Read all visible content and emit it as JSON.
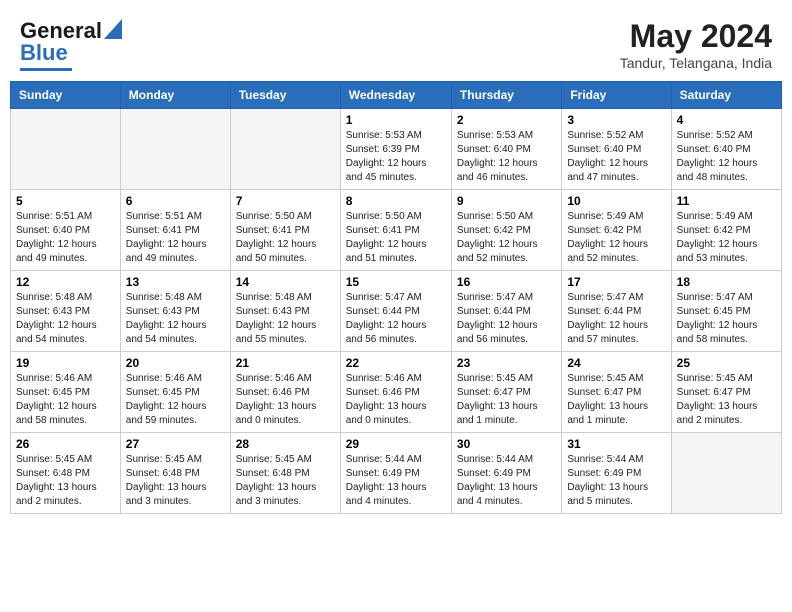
{
  "header": {
    "logo_line1": "General",
    "logo_line2": "Blue",
    "title": "May 2024",
    "subtitle": "Tandur, Telangana, India"
  },
  "days_of_week": [
    "Sunday",
    "Monday",
    "Tuesday",
    "Wednesday",
    "Thursday",
    "Friday",
    "Saturday"
  ],
  "weeks": [
    [
      {
        "day": "",
        "info": ""
      },
      {
        "day": "",
        "info": ""
      },
      {
        "day": "",
        "info": ""
      },
      {
        "day": "1",
        "info": "Sunrise: 5:53 AM\nSunset: 6:39 PM\nDaylight: 12 hours\nand 45 minutes."
      },
      {
        "day": "2",
        "info": "Sunrise: 5:53 AM\nSunset: 6:40 PM\nDaylight: 12 hours\nand 46 minutes."
      },
      {
        "day": "3",
        "info": "Sunrise: 5:52 AM\nSunset: 6:40 PM\nDaylight: 12 hours\nand 47 minutes."
      },
      {
        "day": "4",
        "info": "Sunrise: 5:52 AM\nSunset: 6:40 PM\nDaylight: 12 hours\nand 48 minutes."
      }
    ],
    [
      {
        "day": "5",
        "info": "Sunrise: 5:51 AM\nSunset: 6:40 PM\nDaylight: 12 hours\nand 49 minutes."
      },
      {
        "day": "6",
        "info": "Sunrise: 5:51 AM\nSunset: 6:41 PM\nDaylight: 12 hours\nand 49 minutes."
      },
      {
        "day": "7",
        "info": "Sunrise: 5:50 AM\nSunset: 6:41 PM\nDaylight: 12 hours\nand 50 minutes."
      },
      {
        "day": "8",
        "info": "Sunrise: 5:50 AM\nSunset: 6:41 PM\nDaylight: 12 hours\nand 51 minutes."
      },
      {
        "day": "9",
        "info": "Sunrise: 5:50 AM\nSunset: 6:42 PM\nDaylight: 12 hours\nand 52 minutes."
      },
      {
        "day": "10",
        "info": "Sunrise: 5:49 AM\nSunset: 6:42 PM\nDaylight: 12 hours\nand 52 minutes."
      },
      {
        "day": "11",
        "info": "Sunrise: 5:49 AM\nSunset: 6:42 PM\nDaylight: 12 hours\nand 53 minutes."
      }
    ],
    [
      {
        "day": "12",
        "info": "Sunrise: 5:48 AM\nSunset: 6:43 PM\nDaylight: 12 hours\nand 54 minutes."
      },
      {
        "day": "13",
        "info": "Sunrise: 5:48 AM\nSunset: 6:43 PM\nDaylight: 12 hours\nand 54 minutes."
      },
      {
        "day": "14",
        "info": "Sunrise: 5:48 AM\nSunset: 6:43 PM\nDaylight: 12 hours\nand 55 minutes."
      },
      {
        "day": "15",
        "info": "Sunrise: 5:47 AM\nSunset: 6:44 PM\nDaylight: 12 hours\nand 56 minutes."
      },
      {
        "day": "16",
        "info": "Sunrise: 5:47 AM\nSunset: 6:44 PM\nDaylight: 12 hours\nand 56 minutes."
      },
      {
        "day": "17",
        "info": "Sunrise: 5:47 AM\nSunset: 6:44 PM\nDaylight: 12 hours\nand 57 minutes."
      },
      {
        "day": "18",
        "info": "Sunrise: 5:47 AM\nSunset: 6:45 PM\nDaylight: 12 hours\nand 58 minutes."
      }
    ],
    [
      {
        "day": "19",
        "info": "Sunrise: 5:46 AM\nSunset: 6:45 PM\nDaylight: 12 hours\nand 58 minutes."
      },
      {
        "day": "20",
        "info": "Sunrise: 5:46 AM\nSunset: 6:45 PM\nDaylight: 12 hours\nand 59 minutes."
      },
      {
        "day": "21",
        "info": "Sunrise: 5:46 AM\nSunset: 6:46 PM\nDaylight: 13 hours\nand 0 minutes."
      },
      {
        "day": "22",
        "info": "Sunrise: 5:46 AM\nSunset: 6:46 PM\nDaylight: 13 hours\nand 0 minutes."
      },
      {
        "day": "23",
        "info": "Sunrise: 5:45 AM\nSunset: 6:47 PM\nDaylight: 13 hours\nand 1 minute."
      },
      {
        "day": "24",
        "info": "Sunrise: 5:45 AM\nSunset: 6:47 PM\nDaylight: 13 hours\nand 1 minute."
      },
      {
        "day": "25",
        "info": "Sunrise: 5:45 AM\nSunset: 6:47 PM\nDaylight: 13 hours\nand 2 minutes."
      }
    ],
    [
      {
        "day": "26",
        "info": "Sunrise: 5:45 AM\nSunset: 6:48 PM\nDaylight: 13 hours\nand 2 minutes."
      },
      {
        "day": "27",
        "info": "Sunrise: 5:45 AM\nSunset: 6:48 PM\nDaylight: 13 hours\nand 3 minutes."
      },
      {
        "day": "28",
        "info": "Sunrise: 5:45 AM\nSunset: 6:48 PM\nDaylight: 13 hours\nand 3 minutes."
      },
      {
        "day": "29",
        "info": "Sunrise: 5:44 AM\nSunset: 6:49 PM\nDaylight: 13 hours\nand 4 minutes."
      },
      {
        "day": "30",
        "info": "Sunrise: 5:44 AM\nSunset: 6:49 PM\nDaylight: 13 hours\nand 4 minutes."
      },
      {
        "day": "31",
        "info": "Sunrise: 5:44 AM\nSunset: 6:49 PM\nDaylight: 13 hours\nand 5 minutes."
      },
      {
        "day": "",
        "info": ""
      }
    ]
  ]
}
